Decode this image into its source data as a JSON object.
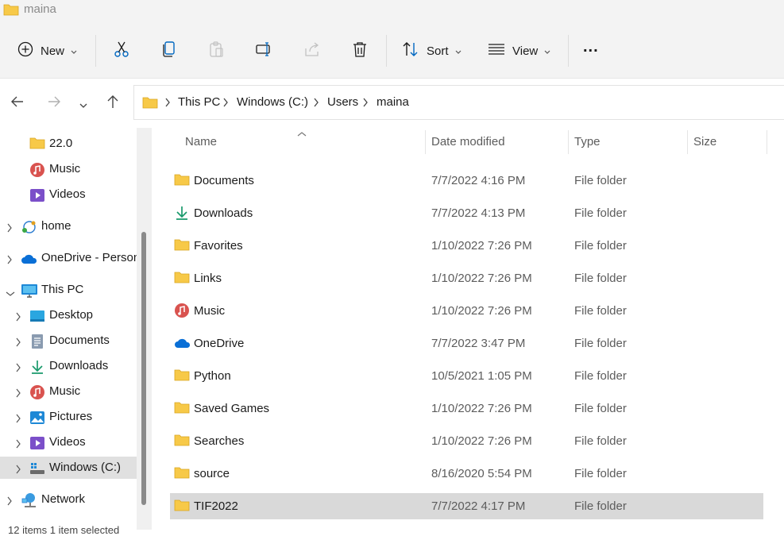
{
  "window": {
    "title": "maina"
  },
  "toolbar": {
    "new_label": "New",
    "sort_label": "Sort",
    "view_label": "View",
    "more_label": "..."
  },
  "address": {
    "crumbs": [
      "This PC",
      "Windows (C:)",
      "Users",
      "maina"
    ]
  },
  "sidebar": {
    "items": [
      {
        "label": "22.0",
        "icon": "folder-icon"
      },
      {
        "label": "Music",
        "icon": "music-icon"
      },
      {
        "label": "Videos",
        "icon": "videos-icon"
      },
      {
        "label": "home",
        "icon": "home-network-icon"
      },
      {
        "label": "OneDrive - Person",
        "icon": "onedrive-icon"
      },
      {
        "label": "This PC",
        "icon": "this-pc-icon"
      },
      {
        "label": "Desktop",
        "icon": "desktop-icon"
      },
      {
        "label": "Documents",
        "icon": "documents-icon"
      },
      {
        "label": "Downloads",
        "icon": "downloads-icon"
      },
      {
        "label": "Music",
        "icon": "music-icon"
      },
      {
        "label": "Pictures",
        "icon": "pictures-icon"
      },
      {
        "label": "Videos",
        "icon": "videos-icon"
      },
      {
        "label": "Windows (C:)",
        "icon": "drive-icon"
      },
      {
        "label": "Network",
        "icon": "network-icon"
      }
    ]
  },
  "columns": {
    "name": "Name",
    "date": "Date modified",
    "type": "Type",
    "size": "Size"
  },
  "files": [
    {
      "name": "Documents",
      "date": "7/7/2022 4:16 PM",
      "type": "File folder",
      "icon": "folder-icon"
    },
    {
      "name": "Downloads",
      "date": "7/7/2022 4:13 PM",
      "type": "File folder",
      "icon": "downloads-icon"
    },
    {
      "name": "Favorites",
      "date": "1/10/2022 7:26 PM",
      "type": "File folder",
      "icon": "folder-icon"
    },
    {
      "name": "Links",
      "date": "1/10/2022 7:26 PM",
      "type": "File folder",
      "icon": "folder-icon"
    },
    {
      "name": "Music",
      "date": "1/10/2022 7:26 PM",
      "type": "File folder",
      "icon": "music-icon"
    },
    {
      "name": "OneDrive",
      "date": "7/7/2022 3:47 PM",
      "type": "File folder",
      "icon": "onedrive-icon"
    },
    {
      "name": "Python",
      "date": "10/5/2021 1:05 PM",
      "type": "File folder",
      "icon": "folder-icon"
    },
    {
      "name": "Saved Games",
      "date": "1/10/2022 7:26 PM",
      "type": "File folder",
      "icon": "folder-icon"
    },
    {
      "name": "Searches",
      "date": "1/10/2022 7:26 PM",
      "type": "File folder",
      "icon": "folder-icon"
    },
    {
      "name": "source",
      "date": "8/16/2020 5:54 PM",
      "type": "File folder",
      "icon": "folder-icon"
    },
    {
      "name": "TIF2022",
      "date": "7/7/2022 4:17 PM",
      "type": "File folder",
      "icon": "folder-icon"
    }
  ],
  "status": {
    "text": "12 items    1 item selected"
  },
  "colors": {
    "folder": "#f7c948",
    "accent": "#0067c0",
    "selection": "#d9d9d9",
    "toolbar_bg": "#f3f3f3"
  }
}
